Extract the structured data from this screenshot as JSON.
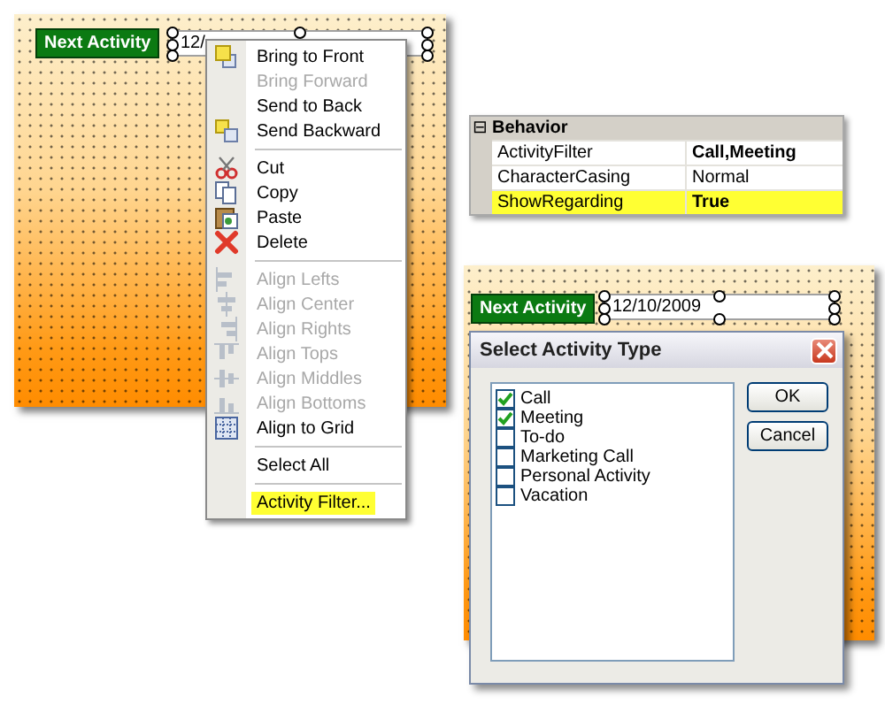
{
  "designer_top": {
    "label": "Next Activity",
    "field_value": "12/"
  },
  "context_menu": {
    "items": [
      {
        "kind": "item",
        "label": "Bring to Front",
        "disabled": false,
        "highlighted": false
      },
      {
        "kind": "item",
        "label": "Bring Forward",
        "disabled": true,
        "highlighted": false
      },
      {
        "kind": "item",
        "label": "Send to Back",
        "disabled": false,
        "highlighted": false
      },
      {
        "kind": "item",
        "label": "Send Backward",
        "disabled": false,
        "highlighted": false
      },
      {
        "kind": "separator"
      },
      {
        "kind": "item",
        "label": "Cut",
        "disabled": false,
        "highlighted": false
      },
      {
        "kind": "item",
        "label": "Copy",
        "disabled": false,
        "highlighted": false
      },
      {
        "kind": "item",
        "label": "Paste",
        "disabled": false,
        "highlighted": false
      },
      {
        "kind": "item",
        "label": "Delete",
        "disabled": false,
        "highlighted": false
      },
      {
        "kind": "separator"
      },
      {
        "kind": "item",
        "label": "Align Lefts",
        "disabled": true,
        "highlighted": false
      },
      {
        "kind": "item",
        "label": "Align Center",
        "disabled": true,
        "highlighted": false
      },
      {
        "kind": "item",
        "label": "Align Rights",
        "disabled": true,
        "highlighted": false
      },
      {
        "kind": "item",
        "label": "Align Tops",
        "disabled": true,
        "highlighted": false
      },
      {
        "kind": "item",
        "label": "Align Middles",
        "disabled": true,
        "highlighted": false
      },
      {
        "kind": "item",
        "label": "Align Bottoms",
        "disabled": true,
        "highlighted": false
      },
      {
        "kind": "item",
        "label": "Align to Grid",
        "disabled": false,
        "highlighted": false
      },
      {
        "kind": "separator"
      },
      {
        "kind": "item",
        "label": "Select All",
        "disabled": false,
        "highlighted": false
      },
      {
        "kind": "separator"
      },
      {
        "kind": "item",
        "label": "Activity Filter...",
        "disabled": false,
        "highlighted": true
      }
    ]
  },
  "property_grid": {
    "category": "Behavior",
    "expanded": true,
    "expander": "⊟",
    "rows": [
      {
        "name": "ActivityFilter",
        "value": "Call,Meeting",
        "modified": true,
        "highlighted": false
      },
      {
        "name": "CharacterCasing",
        "value": "Normal",
        "modified": false,
        "highlighted": false
      },
      {
        "name": "ShowRegarding",
        "value": "True",
        "modified": true,
        "highlighted": true
      }
    ]
  },
  "designer_bottom": {
    "label": "Next Activity",
    "field_value": "12/10/2009"
  },
  "dialog": {
    "title": "Select Activity Type",
    "items": [
      {
        "label": "Call",
        "checked": true
      },
      {
        "label": "Meeting",
        "checked": true
      },
      {
        "label": "To-do",
        "checked": false
      },
      {
        "label": "Marketing Call",
        "checked": false
      },
      {
        "label": "Personal Activity",
        "checked": false
      },
      {
        "label": "Vacation",
        "checked": false
      }
    ],
    "buttons": [
      "OK",
      "Cancel"
    ]
  }
}
